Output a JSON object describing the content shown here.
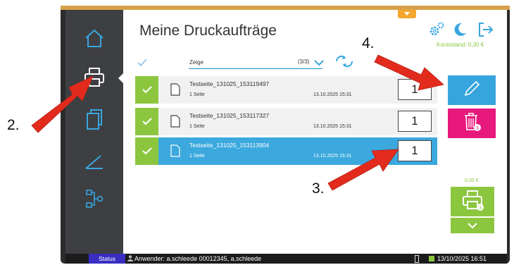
{
  "header": {
    "title": "Meine Druckaufträge",
    "balance": "Kontostand: 0,30 €"
  },
  "filter": {
    "label": "Zeige",
    "counter": "(3/3)"
  },
  "jobs": [
    {
      "name": "Testseite_131025_153119497",
      "pages": "1 Seite",
      "date": "13.10.2025 15:31",
      "copies": "1",
      "selected": false
    },
    {
      "name": "Testseite_131025_153117327",
      "pages": "1 Seite",
      "date": "13.10.2025 15:31",
      "copies": "1",
      "selected": false
    },
    {
      "name": "Testseite_131025_153113904",
      "pages": "1 Seite",
      "date": "13.10.2025 15:31",
      "copies": "1",
      "selected": true
    }
  ],
  "actions": {
    "delete_badge": "3",
    "print_badge": "3",
    "price": "0,00 €"
  },
  "statusbar": {
    "status_label": "Status",
    "user": "Anwender: a.schleede 00012345, a.schleede",
    "datetime": "13/10/2025 16:51"
  },
  "callouts": {
    "c2": "2.",
    "c3": "3.",
    "c4": "4."
  },
  "colors": {
    "green": "#8cc63f",
    "blue": "#36a5de",
    "pink": "#e8197c",
    "arrow_red": "#e32b1d",
    "sidebar": "#3d3f43"
  },
  "icons": [
    "home-icon",
    "printer-icon",
    "copy-icon",
    "scan-icon",
    "workflow-icon",
    "gear-icon",
    "moon-icon",
    "logout-icon",
    "document-icon",
    "pencil-icon",
    "trash-icon",
    "refresh-icon",
    "chevron-down-icon",
    "check-icon",
    "user-icon",
    "battery-icon"
  ]
}
